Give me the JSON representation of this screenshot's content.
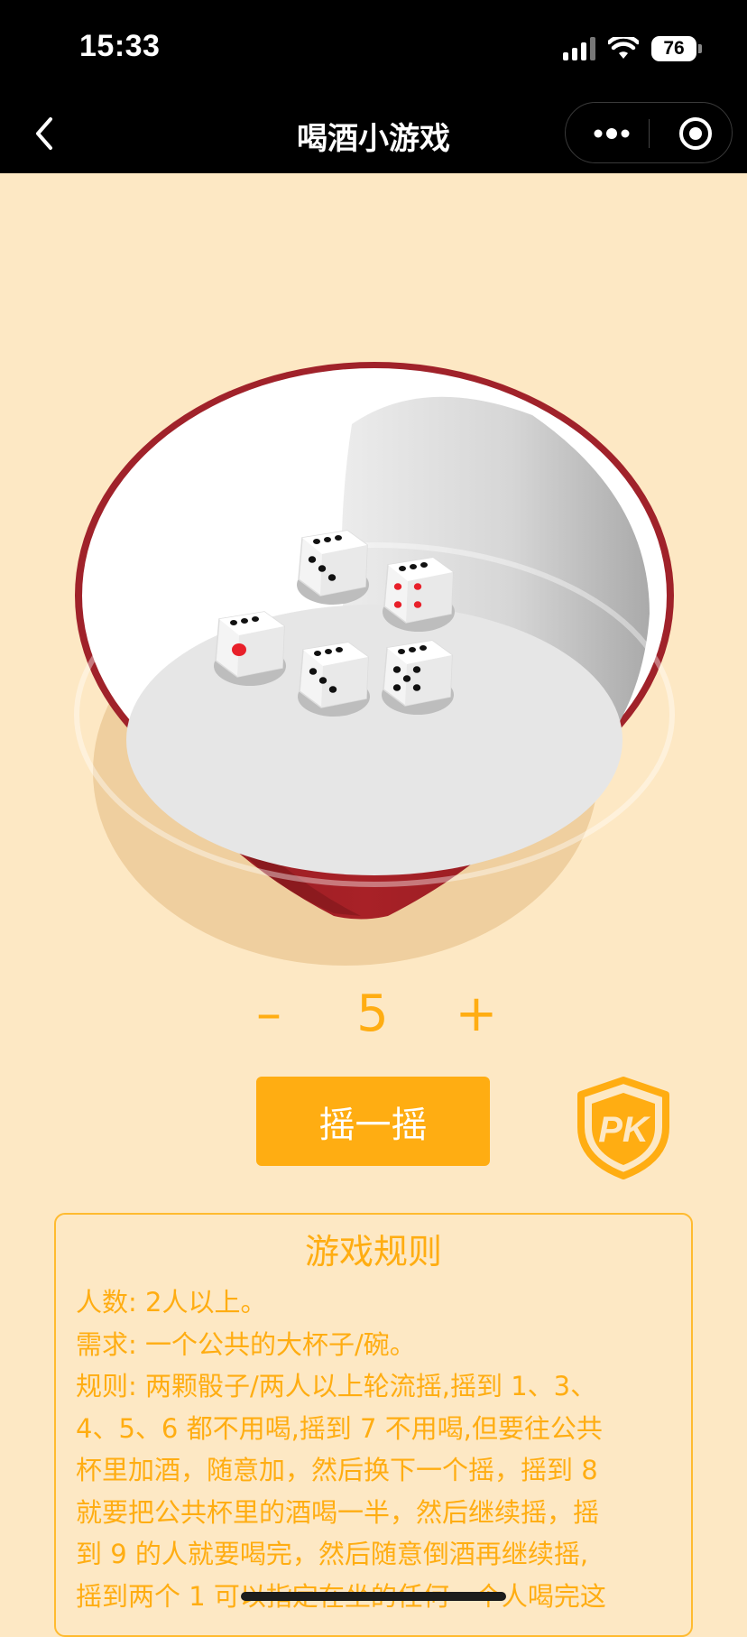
{
  "status_bar": {
    "time": "15:33",
    "battery": "76",
    "icons": [
      "signal-icon",
      "wifi-icon",
      "battery-icon"
    ]
  },
  "nav": {
    "title": "喝酒小游戏",
    "icons": [
      "back-icon",
      "more-icon",
      "target-icon"
    ]
  },
  "dice": {
    "faces": [
      1,
      3,
      3,
      5,
      4
    ],
    "pip_colors": {
      "one_and_four": "#e8202a",
      "others": "#111111"
    }
  },
  "counter": {
    "minus": "–",
    "value": "5",
    "plus": "+"
  },
  "shake_button": {
    "label": "摇一摇"
  },
  "pk_badge": {
    "label": "PK"
  },
  "rules": {
    "title": "游戏规则",
    "lines": [
      "人数: 2人以上。",
      "需求: 一个公共的大杯子/碗。",
      "规则: 两颗骰子/两人以上轮流摇,摇到 1、3、",
      "4、5、6 都不用喝,摇到 7 不用喝,但要往公共",
      "杯里加酒，随意加，然后换下一个摇，摇到 8",
      "就要把公共杯里的酒喝一半，然后继续摇，摇",
      "到 9 的人就要喝完，然后随意倒酒再继续摇,",
      "摇到两个 1 可以指定在坐的任何一个人喝完这"
    ]
  },
  "colors": {
    "accent": "#ffad12",
    "background": "#fde8c4",
    "bowl_red": "#9e1f24",
    "bar_black": "#000000"
  }
}
